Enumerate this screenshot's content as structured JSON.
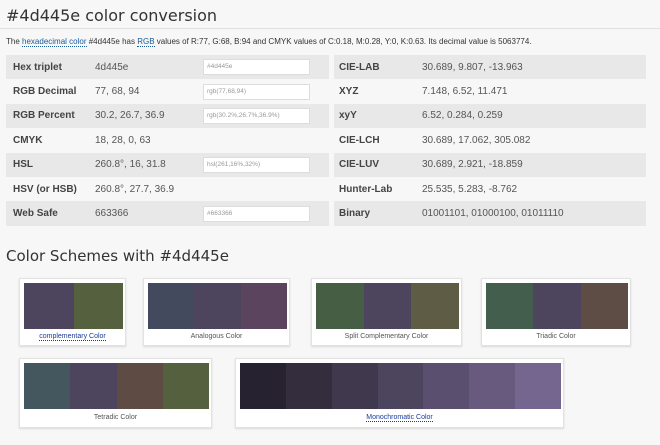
{
  "title": "#4d445e color conversion",
  "intro": {
    "pre": "The ",
    "link_hex": "hexadecimal color",
    "mid1": " #4d445e has ",
    "link_rgb": "RGB",
    "rest": " values of R:77, G:68, B:94 and CMYK values of C:0.18, M:0.28, Y:0, K:0.63. Its decimal value is 5063774."
  },
  "rows": [
    {
      "label": "Hex triplet",
      "value": "4d445e",
      "css": "#4d445e",
      "label2": "CIE-LAB",
      "value2": "30.689, 9.807, -13.963"
    },
    {
      "label": "RGB Decimal",
      "value": "77, 68, 94",
      "css": "rgb(77,68,94)",
      "label2": "XYZ",
      "value2": "7.148, 6.52, 11.471"
    },
    {
      "label": "RGB Percent",
      "value": "30.2, 26.7, 36.9",
      "css": "rgb(30.2%,26.7%,36.9%)",
      "label2": "xyY",
      "value2": "6.52, 0.284, 0.259"
    },
    {
      "label": "CMYK",
      "value": "18, 28, 0, 63",
      "css": "",
      "label2": "CIE-LCH",
      "value2": "30.689, 17.062, 305.082"
    },
    {
      "label": "HSL",
      "value": "260.8°, 16, 31.8",
      "css": "hsl(261,16%,32%)",
      "label2": "CIE-LUV",
      "value2": "30.689, 2.921, -18.859"
    },
    {
      "label": "HSV (or HSB)",
      "value": "260.8°, 27.7, 36.9",
      "css": "",
      "label2": "Hunter-Lab",
      "value2": "25.535, 5.283, -8.762"
    },
    {
      "label": "Web Safe",
      "value": "663366",
      "css": "#663366",
      "label2": "Binary",
      "value2": "01001101, 01000100, 01011110"
    }
  ],
  "schemes_title": "Color Schemes with #4d445e",
  "schemes": [
    {
      "label": "complementary Color",
      "link": true,
      "colors": [
        "#4d445e",
        "#55603f"
      ]
    },
    {
      "label": "Analogous Color",
      "link": false,
      "colors": [
        "#444a5e",
        "#4d445e",
        "#5a445e"
      ]
    },
    {
      "label": "Split Complementary Color",
      "link": false,
      "colors": [
        "#465e44",
        "#4d445e",
        "#5e5c44"
      ]
    },
    {
      "label": "Triadic Color",
      "link": false,
      "colors": [
        "#445e4d",
        "#4d445e",
        "#5e4d44"
      ]
    },
    {
      "label": "Tetradic Color",
      "link": false,
      "colors": [
        "#44575e",
        "#4d445e",
        "#5e4b44",
        "#55603f"
      ]
    },
    {
      "label": "Monochromatic Color",
      "link": true,
      "colors": [
        "#26222f",
        "#332d3e",
        "#40394e",
        "#4d445e",
        "#5a4f6e",
        "#675a7e",
        "#74668e"
      ]
    }
  ]
}
